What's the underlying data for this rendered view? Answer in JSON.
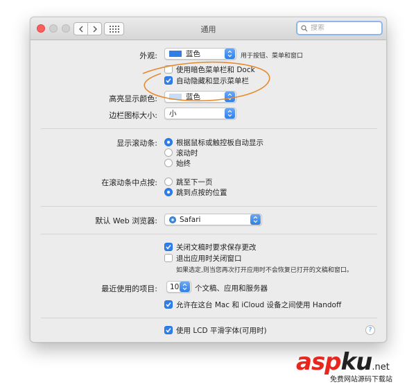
{
  "window": {
    "title": "通用"
  },
  "search": {
    "placeholder": "搜索"
  },
  "appearance": {
    "label": "外观:",
    "value": "蓝色",
    "hint": "用于按钮、菜单和窗口",
    "accent_color": "#2f7fe6"
  },
  "dark_menu": {
    "label": "使用暗色菜单栏和 Dock",
    "checked": false
  },
  "auto_hide_menu": {
    "label": "自动隐藏和显示菜单栏",
    "checked": true
  },
  "highlight": {
    "label": "高亮显示颜色:",
    "value": "蓝色",
    "swatch_color": "#c6dcf7"
  },
  "sidebar_icon": {
    "label": "边栏图标大小:",
    "value": "小"
  },
  "scrollbars": {
    "label": "显示滚动条:",
    "options": [
      {
        "label": "根据鼠标或触控板自动显示",
        "selected": true
      },
      {
        "label": "滚动时",
        "selected": false
      },
      {
        "label": "始终",
        "selected": false
      }
    ]
  },
  "scroll_click": {
    "label": "在滚动条中点按:",
    "options": [
      {
        "label": "跳至下一页",
        "selected": false
      },
      {
        "label": "跳到点按的位置",
        "selected": true
      }
    ]
  },
  "browser": {
    "label": "默认 Web 浏览器:",
    "value": "Safari"
  },
  "ask_save": {
    "label": "关闭文稿时要求保存更改",
    "checked": true
  },
  "close_windows": {
    "label": "退出应用时关闭窗口",
    "checked": false
  },
  "close_windows_note": "如果选定,则当您再次打开应用时不会恢复已打开的文稿和窗口。",
  "recent": {
    "label": "最近使用的项目:",
    "value": "10",
    "suffix": "个文稿、应用和服务器"
  },
  "handoff": {
    "label": "允许在这台 Mac 和 iCloud 设备之间使用 Handoff",
    "checked": true
  },
  "lcd": {
    "label": "使用 LCD 平滑字体(可用时)",
    "checked": true
  },
  "help": {
    "glyph": "?"
  },
  "watermark": {
    "brand_red": "asp",
    "brand_dark": "ku",
    "domain": ".net",
    "tagline": "免费网站源码下载站"
  },
  "colors": {
    "accent": "#2f80ec",
    "annotation": "#e68a2e",
    "close_light": "#fc605c"
  }
}
